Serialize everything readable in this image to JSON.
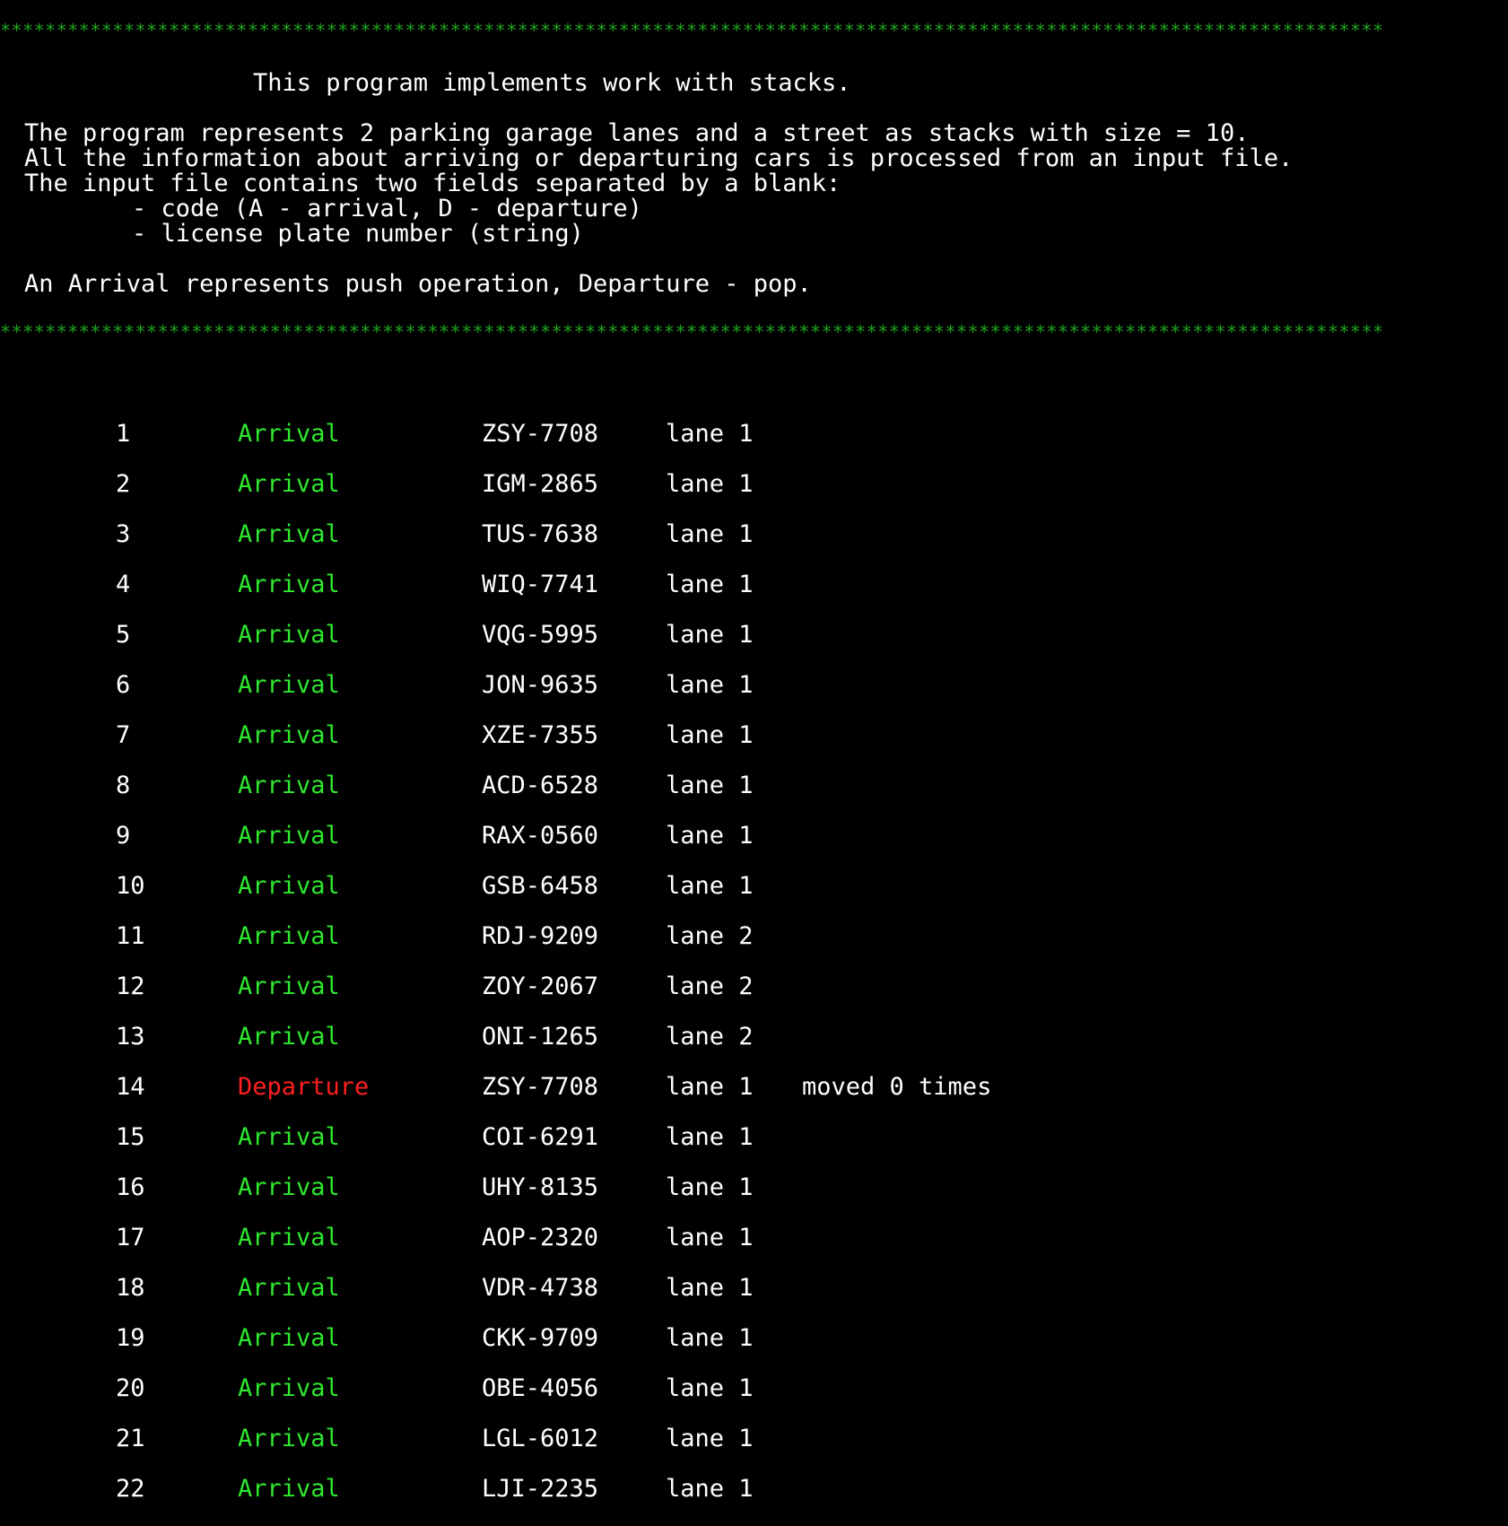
{
  "colors": {
    "background": "#000000",
    "text": "#ffffff",
    "border_stars": "#1fa51f",
    "arrival": "#2ee82e",
    "departure": "#ff1f1f"
  },
  "header": {
    "border": "****************************************************************************************************************************************",
    "title": "This program implements work with stacks.",
    "desc_line1": "The program represents 2 parking garage lanes and a street as stacks with size = 10.",
    "desc_line2": "All the information about arriving or departuring cars is processed from an input file.",
    "desc_line3": "The input file contains two fields separated by a blank:",
    "bullet1": "- code (A - arrival, D - departure)",
    "bullet2": "- license plate number (string)",
    "note": "An Arrival represents push operation, Departure - pop."
  },
  "rows": [
    {
      "num": "1",
      "event": "Arrival",
      "type": "arrival",
      "plate": "ZSY-7708",
      "lane": "lane 1",
      "note": ""
    },
    {
      "num": "2",
      "event": "Arrival",
      "type": "arrival",
      "plate": "IGM-2865",
      "lane": "lane 1",
      "note": ""
    },
    {
      "num": "3",
      "event": "Arrival",
      "type": "arrival",
      "plate": "TUS-7638",
      "lane": "lane 1",
      "note": ""
    },
    {
      "num": "4",
      "event": "Arrival",
      "type": "arrival",
      "plate": "WIQ-7741",
      "lane": "lane 1",
      "note": ""
    },
    {
      "num": "5",
      "event": "Arrival",
      "type": "arrival",
      "plate": "VQG-5995",
      "lane": "lane 1",
      "note": ""
    },
    {
      "num": "6",
      "event": "Arrival",
      "type": "arrival",
      "plate": "JON-9635",
      "lane": "lane 1",
      "note": ""
    },
    {
      "num": "7",
      "event": "Arrival",
      "type": "arrival",
      "plate": "XZE-7355",
      "lane": "lane 1",
      "note": ""
    },
    {
      "num": "8",
      "event": "Arrival",
      "type": "arrival",
      "plate": "ACD-6528",
      "lane": "lane 1",
      "note": ""
    },
    {
      "num": "9",
      "event": "Arrival",
      "type": "arrival",
      "plate": "RAX-0560",
      "lane": "lane 1",
      "note": ""
    },
    {
      "num": "10",
      "event": "Arrival",
      "type": "arrival",
      "plate": "GSB-6458",
      "lane": "lane 1",
      "note": ""
    },
    {
      "num": "11",
      "event": "Arrival",
      "type": "arrival",
      "plate": "RDJ-9209",
      "lane": "lane 2",
      "note": ""
    },
    {
      "num": "12",
      "event": "Arrival",
      "type": "arrival",
      "plate": "ZOY-2067",
      "lane": "lane 2",
      "note": ""
    },
    {
      "num": "13",
      "event": "Arrival",
      "type": "arrival",
      "plate": "ONI-1265",
      "lane": "lane 2",
      "note": ""
    },
    {
      "num": "14",
      "event": "Departure",
      "type": "departure",
      "plate": "ZSY-7708",
      "lane": "lane 1",
      "note": "moved 0 times"
    },
    {
      "num": "15",
      "event": "Arrival",
      "type": "arrival",
      "plate": "COI-6291",
      "lane": "lane 1",
      "note": ""
    },
    {
      "num": "16",
      "event": "Arrival",
      "type": "arrival",
      "plate": "UHY-8135",
      "lane": "lane 1",
      "note": ""
    },
    {
      "num": "17",
      "event": "Arrival",
      "type": "arrival",
      "plate": "AOP-2320",
      "lane": "lane 1",
      "note": ""
    },
    {
      "num": "18",
      "event": "Arrival",
      "type": "arrival",
      "plate": "VDR-4738",
      "lane": "lane 1",
      "note": ""
    },
    {
      "num": "19",
      "event": "Arrival",
      "type": "arrival",
      "plate": "CKK-9709",
      "lane": "lane 1",
      "note": ""
    },
    {
      "num": "20",
      "event": "Arrival",
      "type": "arrival",
      "plate": "OBE-4056",
      "lane": "lane 1",
      "note": ""
    },
    {
      "num": "21",
      "event": "Arrival",
      "type": "arrival",
      "plate": "LGL-6012",
      "lane": "lane 1",
      "note": ""
    },
    {
      "num": "22",
      "event": "Arrival",
      "type": "arrival",
      "plate": "LJI-2235",
      "lane": "lane 1",
      "note": ""
    }
  ]
}
